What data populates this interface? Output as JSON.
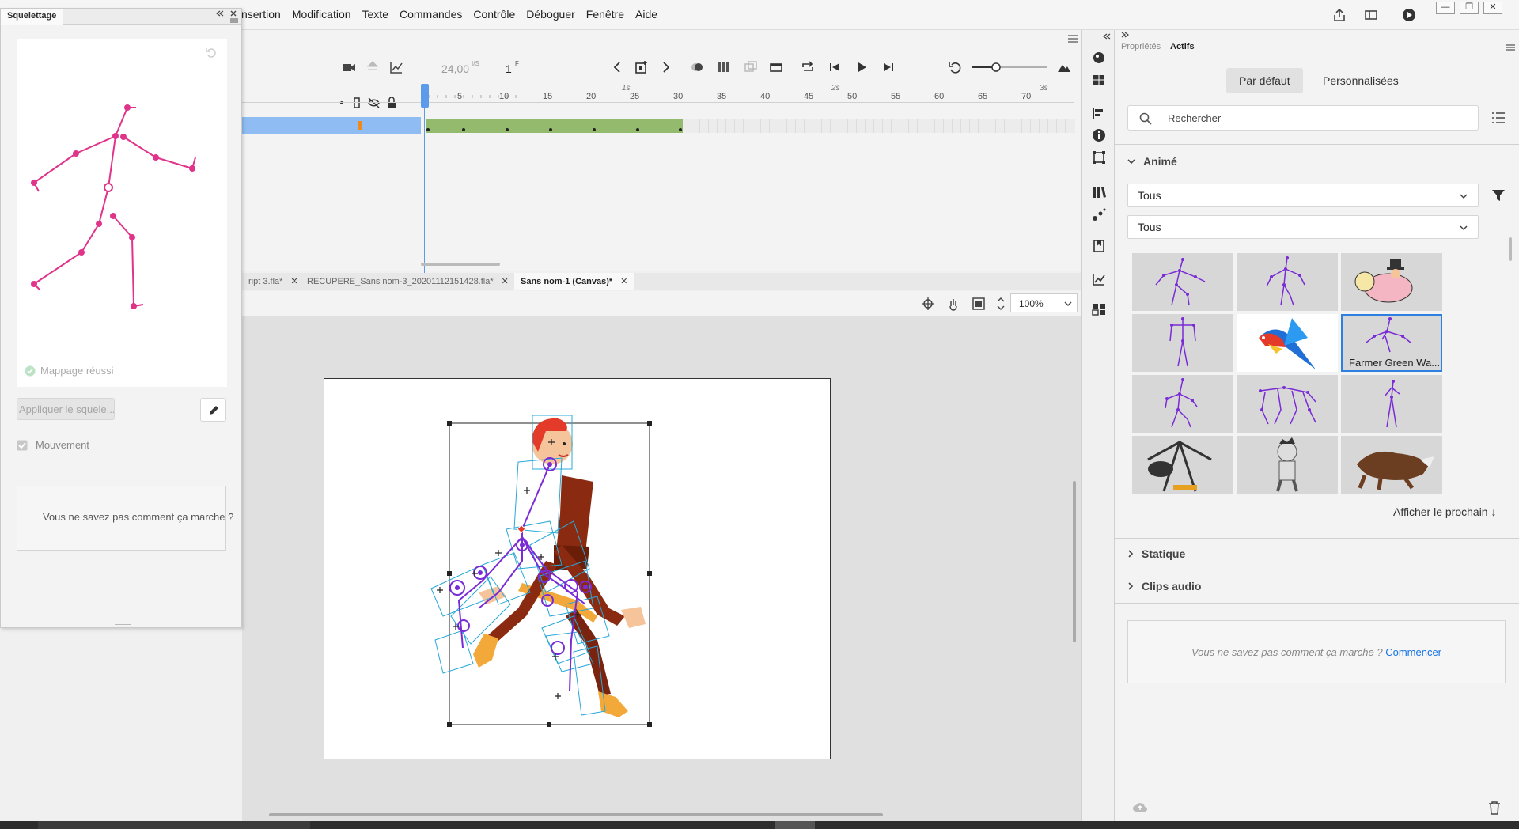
{
  "menu": {
    "items": [
      "nsertion",
      "Modification",
      "Texte",
      "Commandes",
      "Contrôle",
      "Déboguer",
      "Fenêtre",
      "Aide"
    ]
  },
  "skeleton_panel": {
    "tab": "Squelettage",
    "mapping_status": "Mappage réussi",
    "apply_button": "Appliquer le squele...",
    "movement_label": "Mouvement",
    "help_text": "Vous ne savez pas comment ça marche ?"
  },
  "timeline": {
    "fps": "24,00",
    "fps_unit": "I/S",
    "frame": "1",
    "frame_unit": "F",
    "ruler_numbers": [
      "5",
      "10",
      "15",
      "20",
      "25",
      "30",
      "35",
      "40",
      "45",
      "50",
      "55",
      "60",
      "65",
      "70"
    ],
    "ruler_seconds": [
      "1s",
      "2s",
      "3s"
    ]
  },
  "doc_tabs": [
    {
      "label": "ript 3.fla*",
      "active": false
    },
    {
      "label": "RECUPERE_Sans nom-3_20201112151428.fla*",
      "active": false
    },
    {
      "label": "Sans nom-1 (Canvas)*",
      "active": true
    }
  ],
  "stage": {
    "zoom": "100%"
  },
  "assets_panel": {
    "tabs": [
      "Propriétés",
      "Actifs"
    ],
    "segments": [
      "Par défaut",
      "Personnalisées"
    ],
    "search_placeholder": "Rechercher",
    "section_animated": "Animé",
    "filter1": "Tous",
    "filter2": "Tous",
    "selected_caption": "Farmer Green Wa...",
    "show_next": "Afficher le prochain",
    "section_static": "Statique",
    "section_audio": "Clips audio",
    "help_text": "Vous ne savez pas comment ça marche ?",
    "help_link": "Commencer"
  },
  "colors": {
    "accent": "#1473e6",
    "skeleton_pink": "#e0338a",
    "skeleton_purple": "#7a2bd6",
    "frames_green": "#94bb6d",
    "selection_blue": "#8fbdf3"
  }
}
